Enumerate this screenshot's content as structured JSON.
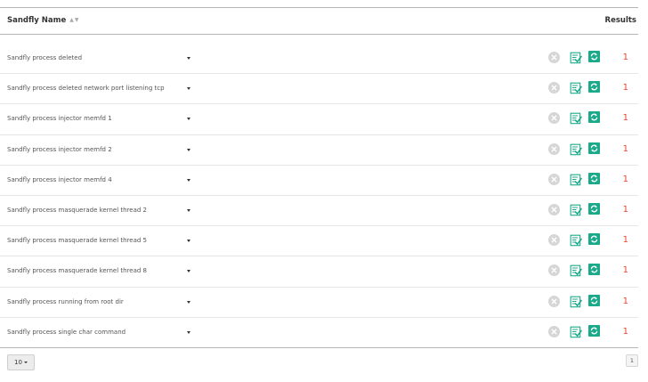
{
  "header": {
    "name_label": "Sandfly Name",
    "results_label": "Results"
  },
  "rows": [
    {
      "name": "Sandfly process deleted",
      "result": "1"
    },
    {
      "name": "Sandfly process deleted network port listening tcp",
      "result": "1"
    },
    {
      "name": "Sandfly process injector memfd 1",
      "result": "1"
    },
    {
      "name": "Sandfly process injector memfd 2",
      "result": "1"
    },
    {
      "name": "Sandfly process injector memfd 4",
      "result": "1"
    },
    {
      "name": "Sandfly process masquerade kernel thread 2",
      "result": "1"
    },
    {
      "name": "Sandfly process masquerade kernel thread 5",
      "result": "1"
    },
    {
      "name": "Sandfly process masquerade kernel thread 8",
      "result": "1"
    },
    {
      "name": "Sandfly process running from root dir",
      "result": "1"
    },
    {
      "name": "Sandfly process single char command",
      "result": "1"
    }
  ],
  "row_icons": {
    "remove": "close-circle-icon",
    "check": "checklist-icon",
    "refresh": "refresh-icon"
  },
  "colors": {
    "result": "#e8472b",
    "refresh_bg": "#1aaa8a",
    "check_green": "#1aaa8a"
  },
  "footer": {
    "page_size": "10",
    "current_page": "1"
  }
}
